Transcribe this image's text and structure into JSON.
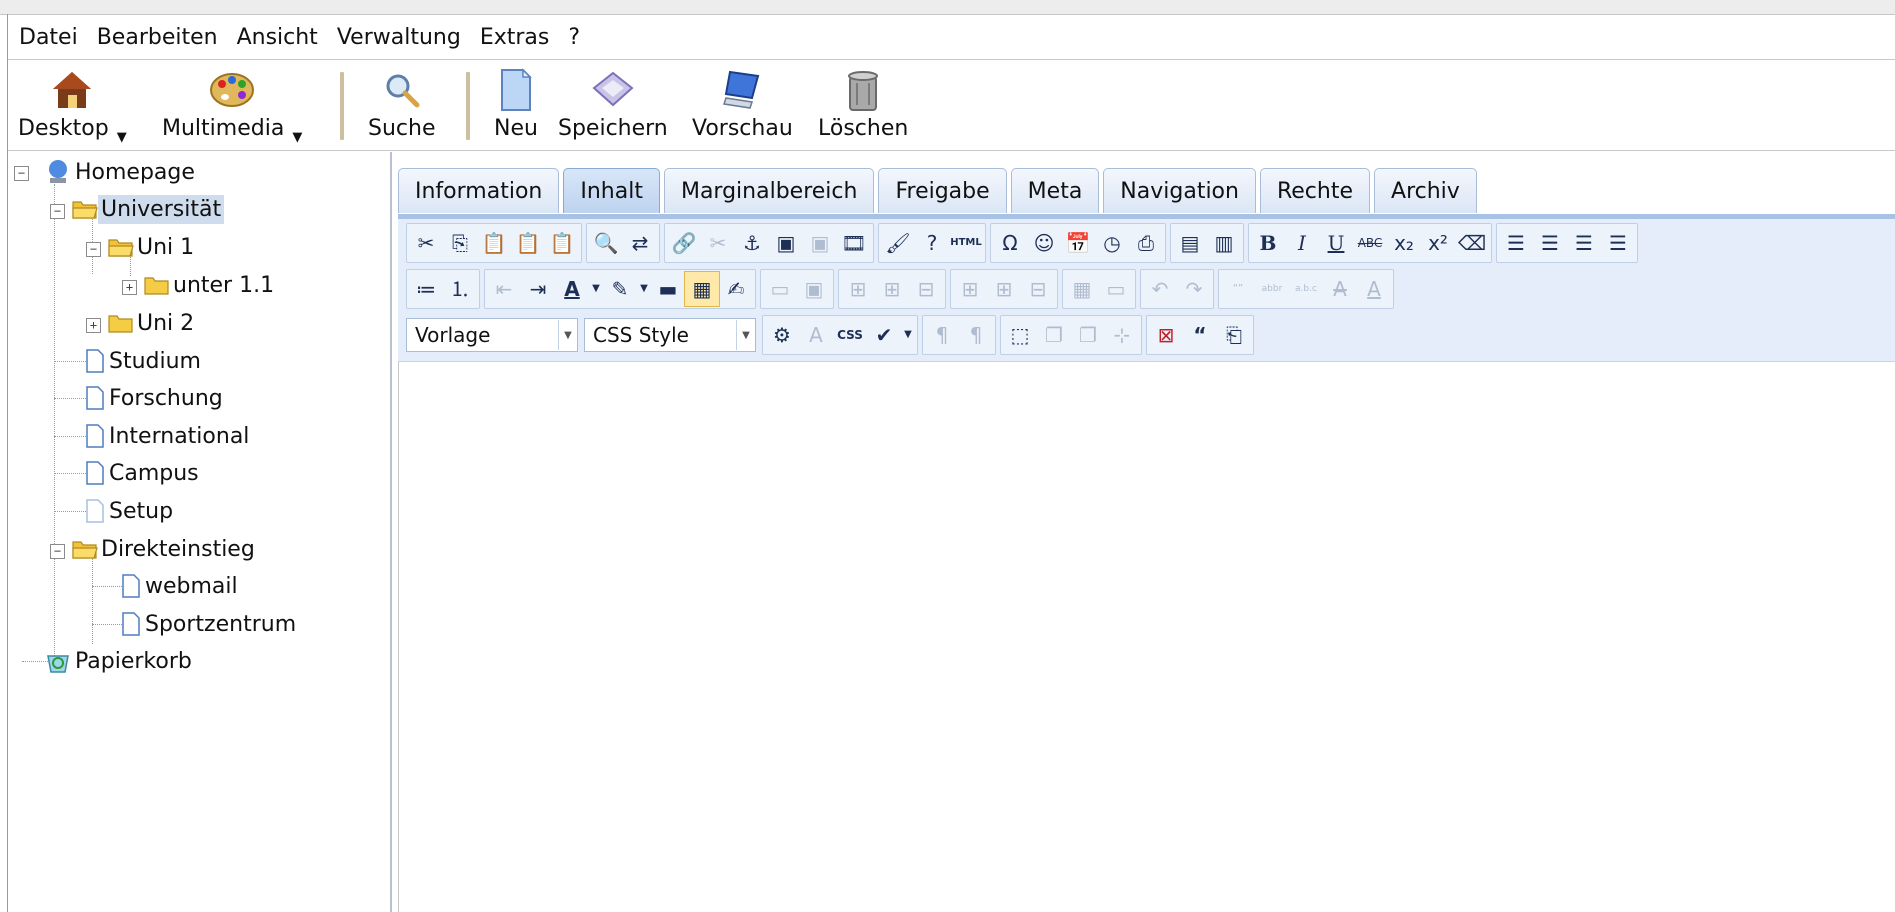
{
  "menu": [
    "Datei",
    "Bearbeiten",
    "Ansicht",
    "Verwaltung",
    "Extras",
    "?"
  ],
  "toolbar": {
    "desktop": "Desktop",
    "multimedia": "Multimedia",
    "suche": "Suche",
    "neu": "Neu",
    "speichern": "Speichern",
    "vorschau": "Vorschau",
    "loeschen": "Löschen"
  },
  "tree": {
    "homepage": "Homepage",
    "universitaet": "Universität",
    "uni1": "Uni 1",
    "unter11": "unter 1.1",
    "uni2": "Uni 2",
    "studium": "Studium",
    "forschung": "Forschung",
    "international": "International",
    "campus": "Campus",
    "setup": "Setup",
    "direkteinstieg": "Direkteinstieg",
    "webmail": "webmail",
    "sportzentrum": "Sportzentrum",
    "papierkorb": "Papierkorb"
  },
  "tabs": [
    "Information",
    "Inhalt",
    "Marginalbereich",
    "Freigabe",
    "Meta",
    "Navigation",
    "Rechte",
    "Archiv"
  ],
  "active_tab": "Inhalt",
  "editor": {
    "vorlage": "Vorlage",
    "css_style": "CSS Style",
    "html_label": "HTML",
    "css_label": "CSS"
  },
  "colors": {
    "selection": "#cfdcee",
    "editor_toolbar": "#e4edf9",
    "tab_accent": "#a8c2e6"
  }
}
